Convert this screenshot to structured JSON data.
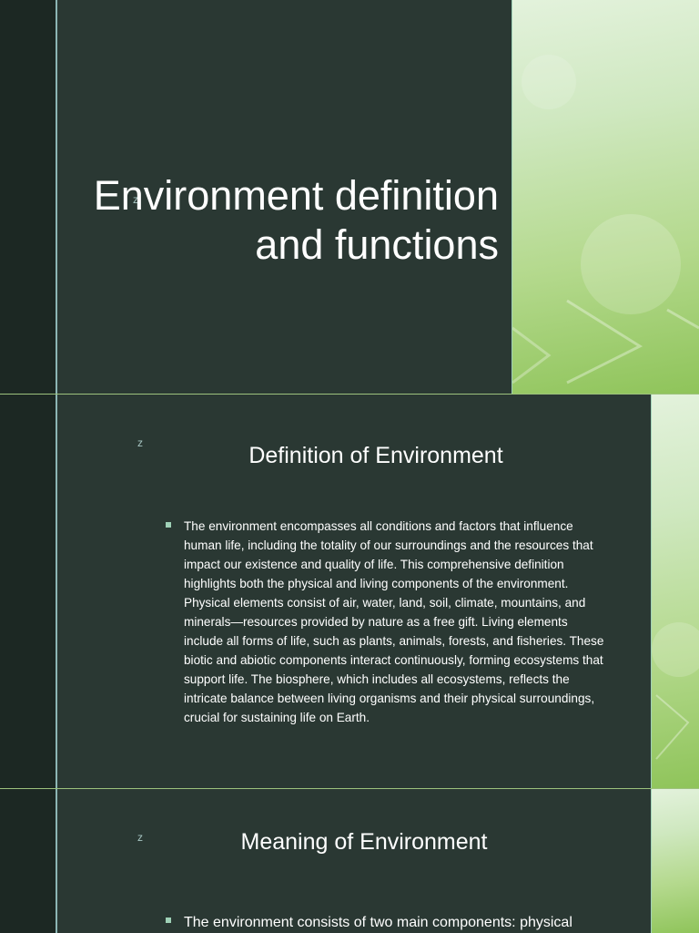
{
  "slides": [
    {
      "title_line1": "Environment definition",
      "title_line2": "and functions",
      "z_mark": "z"
    },
    {
      "heading": "Definition of Environment",
      "z_mark": "z",
      "bullet_text": "The environment encompasses all conditions and factors that influence human life, including the totality of our surroundings and the resources that impact our existence and quality of life. This comprehensive definition highlights both the physical and living components of the environment. Physical elements consist of air, water, land, soil, climate, mountains, and minerals—resources provided by nature as a free gift. Living elements include all forms of life, such as plants, animals, forests, and fisheries. These biotic and abiotic components interact continuously, forming ecosystems that support life. The biosphere, which includes all ecosystems, reflects the intricate balance between living organisms and their physical surroundings, crucial for sustaining life on Earth."
    },
    {
      "heading": "Meaning of Environment",
      "z_mark": "z",
      "bullet_text": "The environment consists of two main components: physical"
    }
  ],
  "colors": {
    "slide_bg": "#2a3833",
    "left_strip": "#1c2823",
    "accent_rule": "#8db7b5",
    "green_panel": "#b4d98d",
    "divider": "#9dc27d"
  }
}
